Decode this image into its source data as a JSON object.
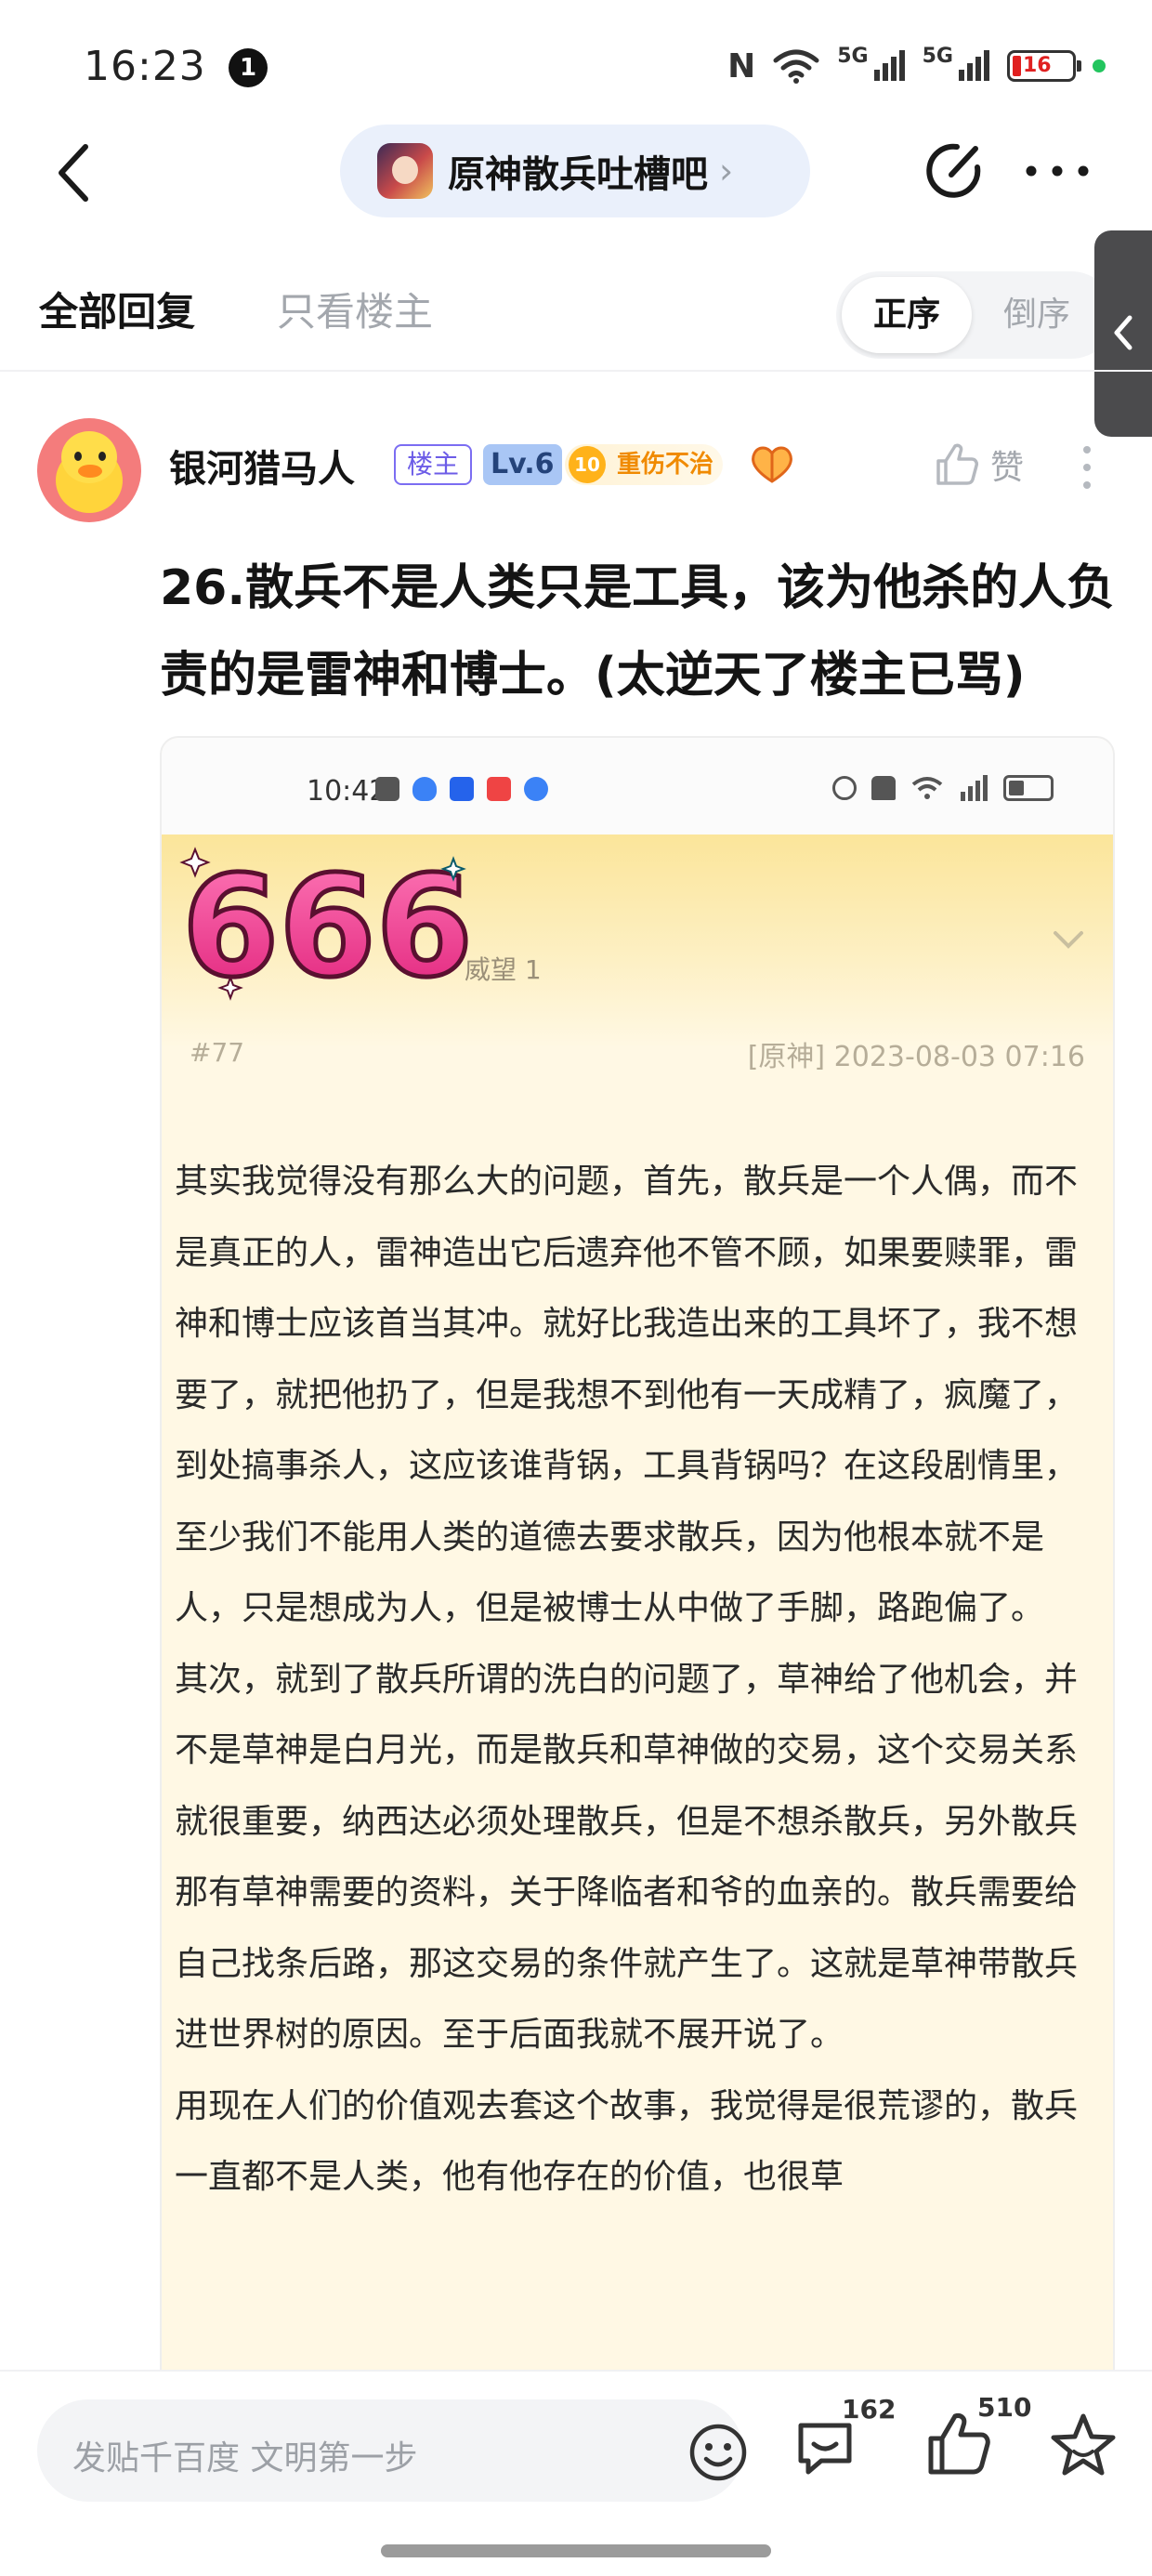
{
  "status_bar": {
    "time": "16:23",
    "notification_count": "1",
    "nfc": "N",
    "network1": "5G",
    "network2": "5G",
    "battery": "16",
    "icons": [
      "nfc-icon",
      "wifi-icon",
      "signal-5g-icon",
      "signal-5g-icon",
      "battery-icon"
    ]
  },
  "nav": {
    "forum_name": "原神散兵吐槽吧",
    "chevron": "›",
    "icons": [
      "back-arrow-icon",
      "edit-icon",
      "more-dots-icon"
    ]
  },
  "tabs": {
    "all_replies": "全部回复",
    "owner_only": "只看楼主",
    "sort_asc": "正序",
    "sort_desc": "倒序"
  },
  "post": {
    "author": "银河猎马人",
    "badge_owner": "楼主",
    "badge_level": "Lv.6",
    "badge_title_num": "10",
    "badge_title": "重伤不治",
    "like_label": "赞",
    "title": "26.散兵不是人类只是工具，该为他杀的人负责的是雷神和博士。(太逆天了楼主已骂)"
  },
  "embedded_screenshot": {
    "time": "10:42",
    "weiwang": "威望 1",
    "floor": "#77",
    "meta": "[原神] 2023-08-03 07:16",
    "sticker_text": "666",
    "paragraphs": [
      "其实我觉得没有那么大的问题，首先，散兵是一个人偶，而不是真正的人，雷神造出它后遗弃他不管不顾，如果要赎罪，雷神和博士应该首当其冲。就好比我造出来的工具坏了，我不想要了，就把他扔了，但是我想不到他有一天成精了，疯魔了，到处搞事杀人，这应该谁背锅，工具背锅吗？在这段剧情里，至少我们不能用人类的道德去要求散兵，因为他根本就不是人，只是想成为人，但是被博士从中做了手脚，路跑偏了。",
      "其次，就到了散兵所谓的洗白的问题了，草神给了他机会，并不是草神是白月光，而是散兵和草神做的交易，这个交易关系就很重要，纳西达必须处理散兵，但是不想杀散兵，另外散兵那有草神需要的资料，关于降临者和爷的血亲的。散兵需要给自己找条后路，那这交易的条件就产生了。这就是草神带散兵进世界树的原因。至于后面我就不展开说了。",
      "用现在人们的价值观去套这个故事，我觉得是很荒谬的，散兵一直都不是人类，他有他存在的价值，也很草"
    ]
  },
  "bottom_bar": {
    "reply_placeholder": "发贴千百度 文明第一步",
    "comment_count": "162",
    "like_count": "510",
    "icons": [
      "emoji-icon",
      "comment-icon",
      "thumbs-up-icon",
      "star-icon"
    ]
  },
  "colors": {
    "accent_purple": "#6c5ce7",
    "level_blue": "#a9c6f5",
    "title_orange": "#f08a00",
    "pill_bg": "#eaf0fb",
    "image_bg": "#fff8e4"
  }
}
